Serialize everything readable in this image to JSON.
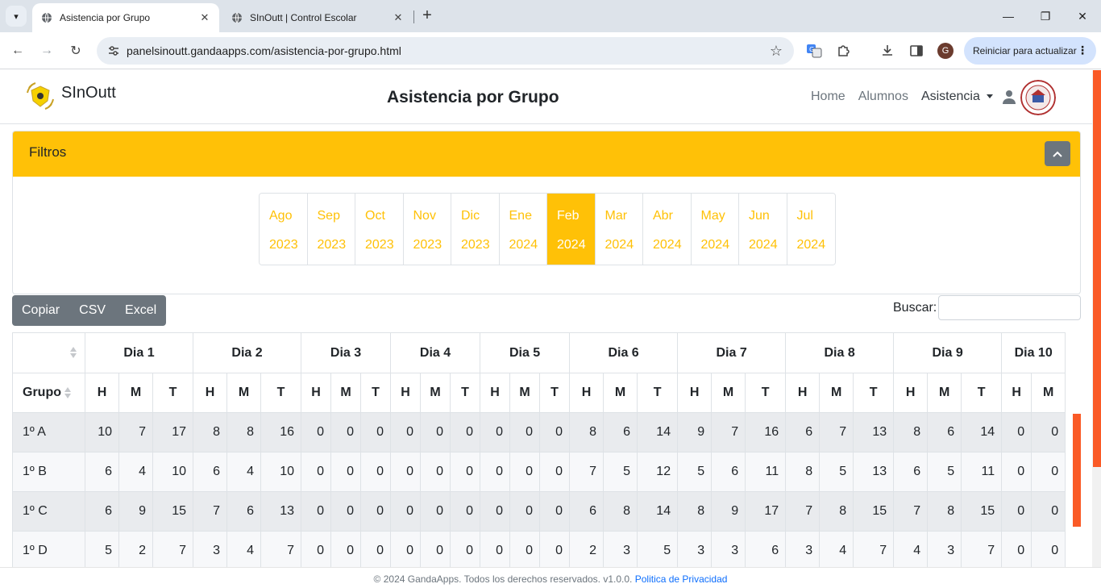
{
  "browser": {
    "tabs": [
      {
        "title": "Asistencia por Grupo",
        "active": true
      },
      {
        "title": "SInOutt | Control Escolar",
        "active": false
      }
    ],
    "url": "panelsinoutt.gandaapps.com/asistencia-por-grupo.html",
    "update_button": "Reiniciar para actualizar",
    "profile_initial": "G"
  },
  "navbar": {
    "brand": "SInOutt",
    "title": "Asistencia por Grupo",
    "links": [
      "Home",
      "Alumnos",
      "Asistencia"
    ]
  },
  "filters": {
    "title": "Filtros",
    "months": [
      {
        "m": "Ago",
        "y": "2023"
      },
      {
        "m": "Sep",
        "y": "2023"
      },
      {
        "m": "Oct",
        "y": "2023"
      },
      {
        "m": "Nov",
        "y": "2023"
      },
      {
        "m": "Dic",
        "y": "2023"
      },
      {
        "m": "Ene",
        "y": "2024"
      },
      {
        "m": "Feb",
        "y": "2024"
      },
      {
        "m": "Mar",
        "y": "2024"
      },
      {
        "m": "Abr",
        "y": "2024"
      },
      {
        "m": "May",
        "y": "2024"
      },
      {
        "m": "Jun",
        "y": "2024"
      },
      {
        "m": "Jul",
        "y": "2024"
      }
    ],
    "active_month_index": 6
  },
  "export_buttons": [
    "Copiar",
    "CSV",
    "Excel"
  ],
  "search_label": "Buscar:",
  "table": {
    "group_header": "Grupo",
    "days": [
      "Dia 1",
      "Dia 2",
      "Dia 3",
      "Dia 4",
      "Dia 5",
      "Dia 6",
      "Dia 7",
      "Dia 8",
      "Dia 9",
      "Dia 10"
    ],
    "sub_headers": [
      "H",
      "M",
      "T"
    ],
    "rows": [
      {
        "grupo": "1º A",
        "values": [
          10,
          7,
          17,
          8,
          8,
          16,
          0,
          0,
          0,
          0,
          0,
          0,
          0,
          0,
          0,
          8,
          6,
          14,
          9,
          7,
          16,
          6,
          7,
          13,
          8,
          6,
          14,
          0,
          0
        ]
      },
      {
        "grupo": "1º B",
        "values": [
          6,
          4,
          10,
          6,
          4,
          10,
          0,
          0,
          0,
          0,
          0,
          0,
          0,
          0,
          0,
          7,
          5,
          12,
          5,
          6,
          11,
          8,
          5,
          13,
          6,
          5,
          11,
          0,
          0
        ]
      },
      {
        "grupo": "1º C",
        "values": [
          6,
          9,
          15,
          7,
          6,
          13,
          0,
          0,
          0,
          0,
          0,
          0,
          0,
          0,
          0,
          6,
          8,
          14,
          8,
          9,
          17,
          7,
          8,
          15,
          7,
          8,
          15,
          0,
          0
        ]
      },
      {
        "grupo": "1º D",
        "values": [
          5,
          2,
          7,
          3,
          4,
          7,
          0,
          0,
          0,
          0,
          0,
          0,
          0,
          0,
          0,
          2,
          3,
          5,
          3,
          3,
          6,
          3,
          4,
          7,
          4,
          3,
          7,
          0,
          0
        ]
      }
    ]
  },
  "footer": {
    "text": "© 2024 GandaApps. Todos los derechos reservados. v1.0.0.",
    "link": "Politica de Privacidad"
  },
  "colors": {
    "accent": "#ffc107",
    "scroll": "#fa5a26",
    "button": "#6c757d"
  }
}
